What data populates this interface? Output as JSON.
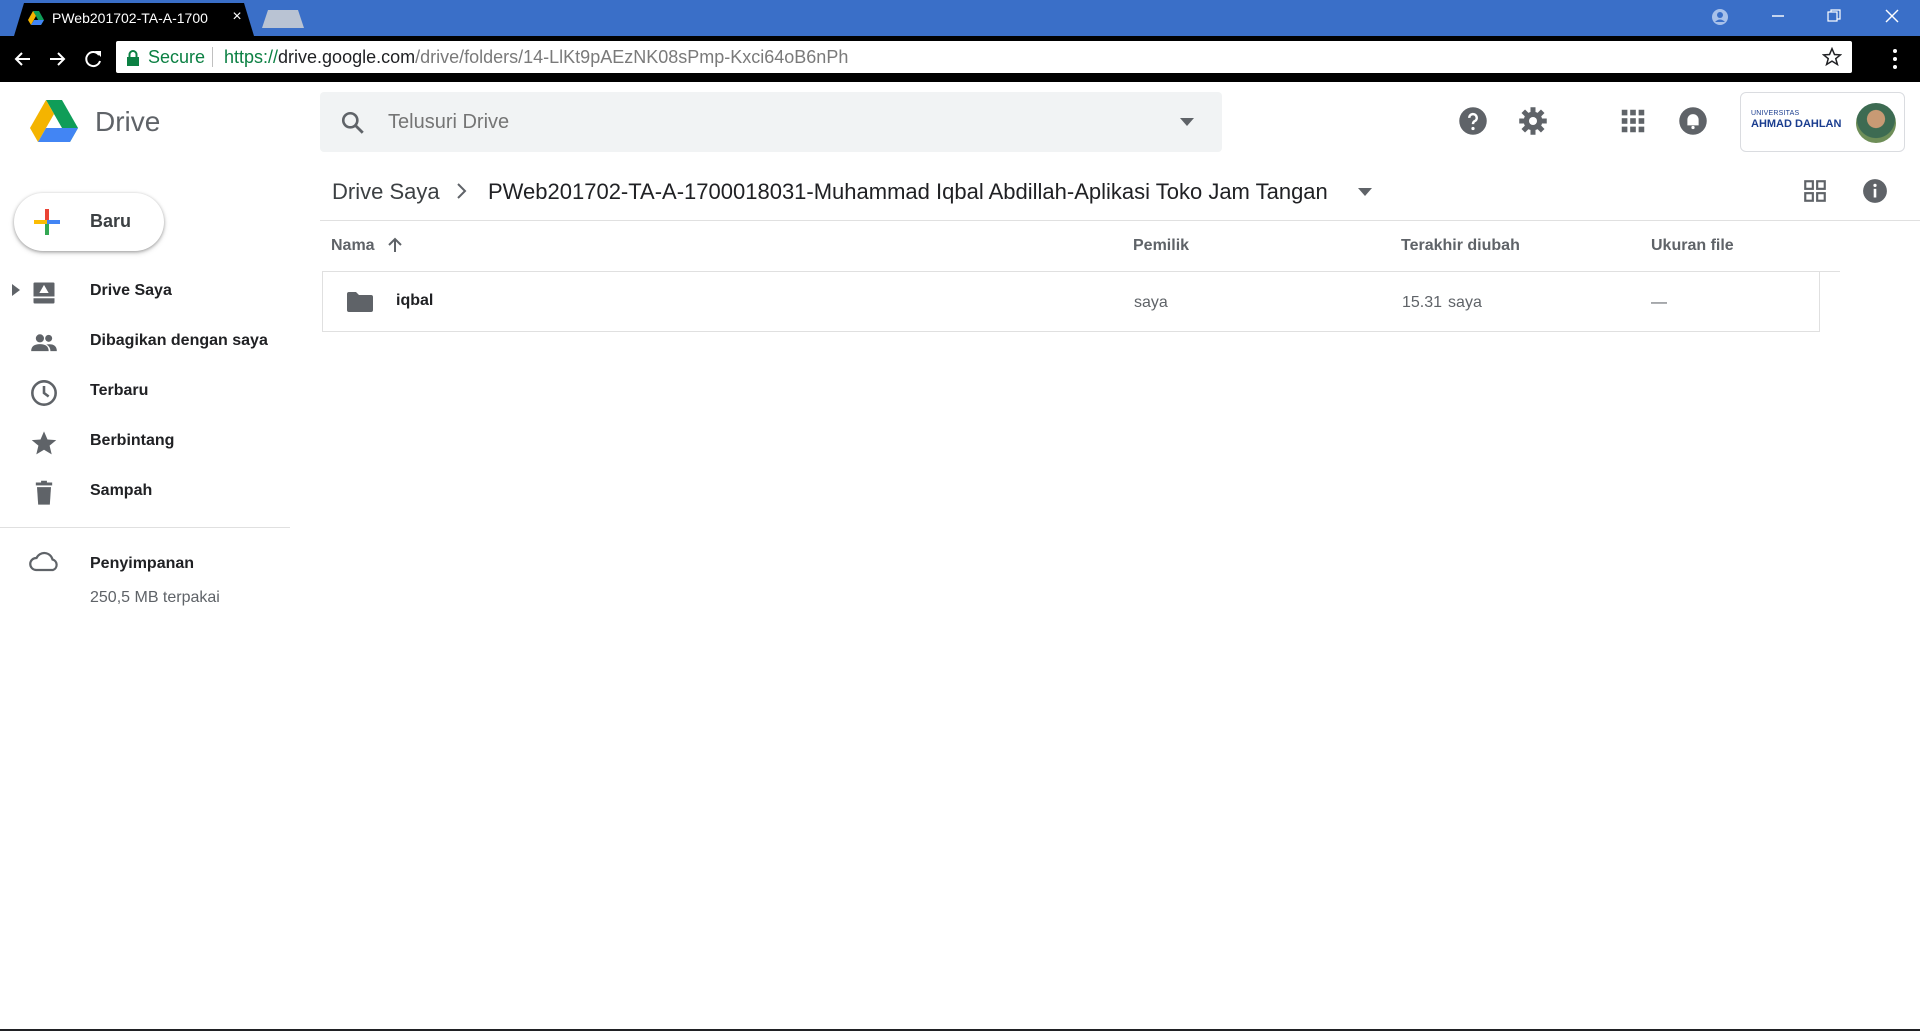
{
  "browser": {
    "tab_title": "PWeb201702-TA-A-1700",
    "tab_close": "×",
    "secure_label": "Secure",
    "url_scheme": "https://",
    "url_host": "drive.google.com",
    "url_path": "/drive/folders/14-LlKt9pAEzNK08sPmp-Kxci64oB6nPh"
  },
  "header": {
    "app_name": "Drive",
    "search_placeholder": "Telusuri Drive",
    "account_org_small": "UNIVERSITAS",
    "account_org_big": "AHMAD DAHLAN"
  },
  "breadcrumb": {
    "root": "Drive Saya",
    "current": "PWeb201702-TA-A-1700018031-Muhammad Iqbal Abdillah-Aplikasi Toko Jam Tangan"
  },
  "sidebar": {
    "new_button": "Baru",
    "items": [
      {
        "label": "Drive Saya",
        "icon": "my-drive-icon"
      },
      {
        "label": "Dibagikan dengan saya",
        "icon": "shared-people-icon"
      },
      {
        "label": "Terbaru",
        "icon": "clock-icon"
      },
      {
        "label": "Berbintang",
        "icon": "star-icon"
      },
      {
        "label": "Sampah",
        "icon": "trash-icon"
      }
    ],
    "storage_label": "Penyimpanan",
    "storage_used": "250,5 MB terpakai"
  },
  "file_list": {
    "columns": {
      "name": "Nama",
      "owner": "Pemilik",
      "modified": "Terakhir diubah",
      "size": "Ukuran file"
    },
    "rows": [
      {
        "name": "iqbal",
        "owner": "saya",
        "modified_time": "15.31",
        "modified_by": "saya",
        "size": "—"
      }
    ]
  },
  "colors": {
    "titlebar": "#3a6fc8",
    "secure_green": "#0b8043",
    "drive_blue": "#4285f4",
    "drive_green": "#0f9d58",
    "drive_yellow": "#f4b400",
    "icon_gray": "#5f6368"
  }
}
